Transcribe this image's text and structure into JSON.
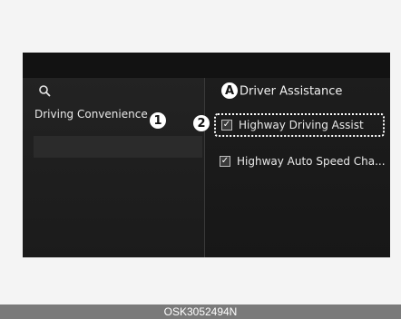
{
  "icons": {
    "search": "search-icon",
    "checkbox": "checkmark-icon"
  },
  "badges": {
    "one": "1",
    "two": "2",
    "a": "A"
  },
  "left_panel": {
    "item_label": "Driving Convenience"
  },
  "right_panel": {
    "title": "Driver Assistance",
    "items": [
      {
        "label": "Highway Driving Assist",
        "checked": true
      },
      {
        "label": "Highway Auto Speed Cha...",
        "checked": true
      }
    ]
  },
  "footer": {
    "code": "OSK3052494N"
  },
  "colors": {
    "screen_bg": "#1a1a1a",
    "text": "#e9e9e9",
    "badge_bg": "#ffffff",
    "footer_bg": "#7a7a7a"
  }
}
